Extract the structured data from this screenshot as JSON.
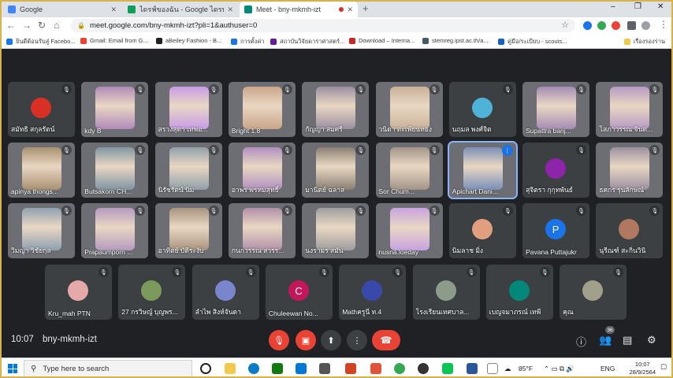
{
  "browser": {
    "tabs": [
      {
        "title": "Google",
        "favicon_color": "#4285f4"
      },
      {
        "title": "ไดรฟ์ของฉัน - Google ไดรฟ์",
        "favicon_color": "#0f9d58"
      },
      {
        "title": "Meet - bny-mkmh-izt",
        "favicon_color": "#00897b"
      }
    ],
    "new_tab": "+",
    "window_controls": [
      "–",
      "❐",
      "✕"
    ],
    "url": "meet.google.com/bny-mkmh-izt?pli=1&authuser=0",
    "bookmarks": [
      "ยินดีต้อนรับสู่ Facebo...",
      "Gmail: Email from G...",
      "aBeiley Fashion - B...",
      "การตั้งค่า",
      "สถาบันวิจัยดาราศาสตร์...",
      "Download – Interna...",
      "stemreg.ipst.ac.th/a...",
      "คู่มือ/ระเบียบ - scouts...",
      "เรื่องรองร่าน"
    ]
  },
  "meet": {
    "participants": [
      {
        "name": "สมัทธิ สกุลรัตน์",
        "type": "avatar",
        "color": "#d93025",
        "initial": "",
        "mic_off": true
      },
      {
        "name": "kdy B",
        "type": "video",
        "color": "#b08ab8",
        "mic_off": true
      },
      {
        "name": "สรวงสุดา เทพอ...",
        "type": "video",
        "color": "#c79be6",
        "mic_off": true
      },
      {
        "name": "Bright 1.8",
        "type": "video",
        "color": "#caa58a",
        "mic_off": true
      },
      {
        "name": "กัญญา สมศรี",
        "type": "video",
        "color": "#9a8ea0",
        "mic_off": true
      },
      {
        "name": "วนิดา ตะเพียนทอง",
        "type": "video",
        "color": "#c9b19a",
        "mic_off": true
      },
      {
        "name": "นฤมล พงศ์จิต",
        "type": "avatar",
        "color": "#4fb3d9",
        "initial": "",
        "mic_off": true
      },
      {
        "name": "Supattra banj...",
        "type": "video",
        "color": "#a58cb5",
        "mic_off": true
      },
      {
        "name": "โสภาวรรณ จินต...",
        "type": "video",
        "color": "#b799c3",
        "mic_off": true
      },
      {
        "name": "apinya thongs...",
        "type": "video",
        "color": "#a89070",
        "mic_off": true
      },
      {
        "name": "Butsakorn CH...",
        "type": "video",
        "color": "#7f95a3",
        "mic_off": true
      },
      {
        "name": "นิรัชรัตน์ นิ่ม",
        "type": "video",
        "color": "#8fa0a8",
        "mic_off": true
      },
      {
        "name": "อาพร พรหมสุทธิ์",
        "type": "video",
        "color": "#b18fbf",
        "mic_off": true
      },
      {
        "name": "มานิตย์ ฉลาส",
        "type": "video",
        "color": "#8a7f73",
        "mic_off": true
      },
      {
        "name": "Sor Chum...",
        "type": "video",
        "color": "#a3948a",
        "mic_off": true
      },
      {
        "name": "Apichart Dani...",
        "type": "video",
        "color": "#7a8fb8",
        "mic_off": false,
        "speaking": true
      },
      {
        "name": "สุจิตรา กุกุทพันธ์",
        "type": "avatar",
        "color": "#8e24aa",
        "initial": "",
        "mic_off": true
      },
      {
        "name": "ธศกร รุ่นลักษณ์",
        "type": "video",
        "color": "#9c8fa1",
        "mic_off": true
      },
      {
        "name": "วิมญา วิชัยกุล",
        "type": "video",
        "color": "#8ea0b0",
        "mic_off": true
      },
      {
        "name": "Prapaumporn ...",
        "type": "video",
        "color": "#b59ac0",
        "mic_off": true
      },
      {
        "name": "อาทิตย์ บัติระงับ",
        "type": "video",
        "color": "#a8937d",
        "mic_off": true
      },
      {
        "name": "กนกวรรณ สวรร...",
        "type": "video",
        "color": "#b08fa8",
        "mic_off": true
      },
      {
        "name": "นงรามร สมัน",
        "type": "video",
        "color": "#9e9e9e",
        "mic_off": true
      },
      {
        "name": "nusna.loeday",
        "type": "video",
        "color": "#c8a2e0",
        "mic_off": true
      },
      {
        "name": "นิมลาช มิ่ง",
        "type": "avatar",
        "color": "#e0a080",
        "initial": "",
        "mic_off": true
      },
      {
        "name": "Pavana Puttajukr",
        "type": "avatar",
        "color": "#1a73e8",
        "initial": "P",
        "mic_off": true
      },
      {
        "name": "นุรีณฑ์ สะกิ่นวินิ",
        "type": "avatar",
        "color": "#b07860",
        "initial": "",
        "mic_off": true
      },
      {
        "name": "Kru_mah PTN",
        "type": "avatar",
        "color": "#e6a9a9",
        "initial": "",
        "mic_off": true
      },
      {
        "name": "27 กรวิษญ์ บุญพร...",
        "type": "avatar",
        "color": "#7c9a5c",
        "initial": "",
        "mic_off": true
      },
      {
        "name": "ลำไพ สิงห์จันดา",
        "type": "avatar",
        "color": "#7986cb",
        "initial": "",
        "mic_off": true
      },
      {
        "name": "Chuleewan No...",
        "type": "avatar",
        "color": "#c2185b",
        "initial": "C",
        "mic_off": true
      },
      {
        "name": "Mathครูนี ท.4",
        "type": "avatar",
        "color": "#3949ab",
        "initial": "",
        "mic_off": true
      },
      {
        "name": "โรงเรียนเทศบาล...",
        "type": "avatar",
        "color": "#8d9b8a",
        "initial": "",
        "mic_off": true
      },
      {
        "name": "เบญจมาภรณ์ เทพี",
        "type": "avatar",
        "color": "#00897b",
        "initial": "",
        "mic_off": true
      },
      {
        "name": "คุณ",
        "type": "avatar",
        "color": "#a0a08c",
        "initial": "",
        "mic_off": true
      }
    ],
    "time": "10:07",
    "meeting_code": "bny-mkmh-izt",
    "participant_count": "36",
    "colors": {
      "danger": "#ea4335",
      "control": "#3c4043",
      "bg": "#202124",
      "speaking": "#1a73e8"
    }
  },
  "taskbar": {
    "search_placeholder": "Type here to search",
    "weather": "85°F",
    "language": "ENG",
    "time": "10:07",
    "date": "28/9/2564"
  }
}
